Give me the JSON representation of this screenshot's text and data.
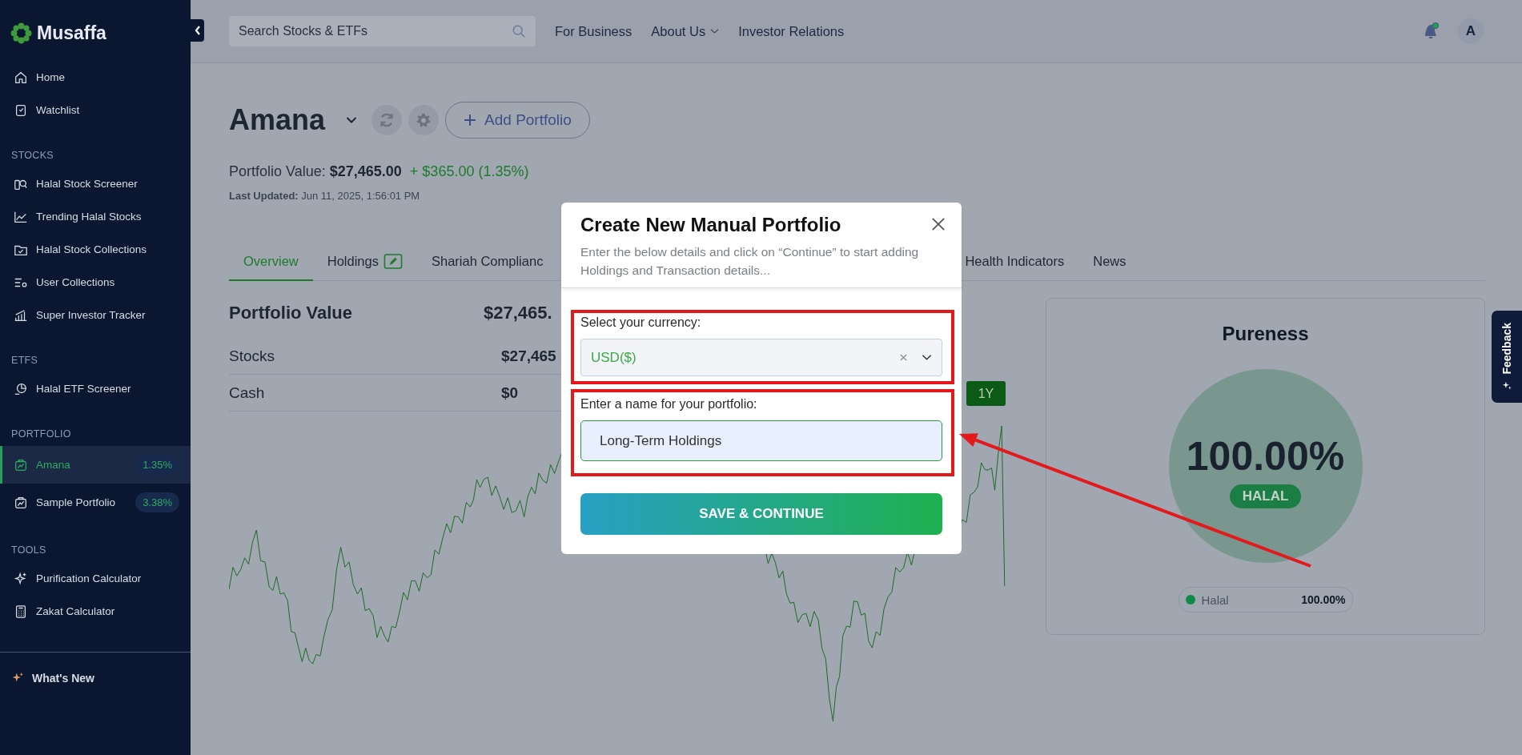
{
  "sidebar": {
    "logo": "Musaffa",
    "top_items": [
      {
        "label": "Home",
        "selected": false
      },
      {
        "label": "Watchlist",
        "selected": false
      }
    ],
    "sections": [
      {
        "heading": "STOCKS",
        "items": [
          {
            "label": "Halal Stock Screener",
            "selected": false
          },
          {
            "label": "Trending Halal Stocks",
            "selected": false
          },
          {
            "label": "Halal Stock Collections",
            "selected": false
          },
          {
            "label": "User Collections",
            "selected": false
          },
          {
            "label": "Super Investor Tracker",
            "selected": false
          }
        ]
      },
      {
        "heading": "ETFS",
        "items": [
          {
            "label": "Halal ETF Screener",
            "selected": false
          }
        ]
      },
      {
        "heading": "PORTFOLIO",
        "items": [
          {
            "label": "Amana",
            "selected": true,
            "badge": "1.35%"
          },
          {
            "label": "Sample Portfolio",
            "selected": false,
            "badge": "3.38%"
          }
        ]
      },
      {
        "heading": "TOOLS",
        "items": [
          {
            "label": "Purification Calculator",
            "selected": false
          },
          {
            "label": "Zakat Calculator",
            "selected": false
          }
        ]
      }
    ],
    "footer_item": "What's New"
  },
  "header": {
    "search": {
      "placeholder": "Search Stocks & ETFs"
    },
    "nav": [
      {
        "label": "For Business",
        "dropdown": false
      },
      {
        "label": "About Us",
        "dropdown": true
      },
      {
        "label": "Investor Relations",
        "dropdown": false
      }
    ],
    "unread_notifications": true,
    "avatar": "A"
  },
  "portfolio": {
    "name": "Amana",
    "add_button": "Add Portfolio",
    "value_label": "Portfolio Value:",
    "value": "$27,465.00",
    "change": "+ $365.00 (1.35%)",
    "updated_label": "Last Updated:",
    "updated": "Jun 11, 2025, 1:56:01 PM"
  },
  "tabs": [
    {
      "label": "Overview",
      "selected": true
    },
    {
      "label": "Holdings",
      "selected": false,
      "editable": true
    },
    {
      "label": "Shariah Complianc",
      "selected": false
    },
    {
      "label": "Health Indicators",
      "selected": false
    },
    {
      "label": "News",
      "selected": false
    }
  ],
  "summary": {
    "title": "Portfolio Value",
    "total": "$27,465.",
    "rows": [
      {
        "label": "Stocks",
        "value": "$27,465"
      },
      {
        "label": "Cash",
        "value": "$0"
      }
    ]
  },
  "range_button": {
    "label": "1Y",
    "selected": true
  },
  "pureness": {
    "title": "Pureness",
    "percent": "100.00%",
    "status": "HALAL",
    "legend": [
      {
        "label": "Halal",
        "value": "100.00%",
        "color": "#0e8a47"
      }
    ]
  },
  "feedback_tab": "Feedback",
  "modal": {
    "title": "Create New Manual Portfolio",
    "description": "Enter the below details and click on “Continue” to start adding Holdings and Transaction details...",
    "currency": {
      "label": "Select your currency:",
      "value": "USD($)"
    },
    "name": {
      "label": "Enter a name for your portfolio:",
      "value": "Long-Term Holdings"
    },
    "submit": "SAVE & CONTINUE"
  }
}
